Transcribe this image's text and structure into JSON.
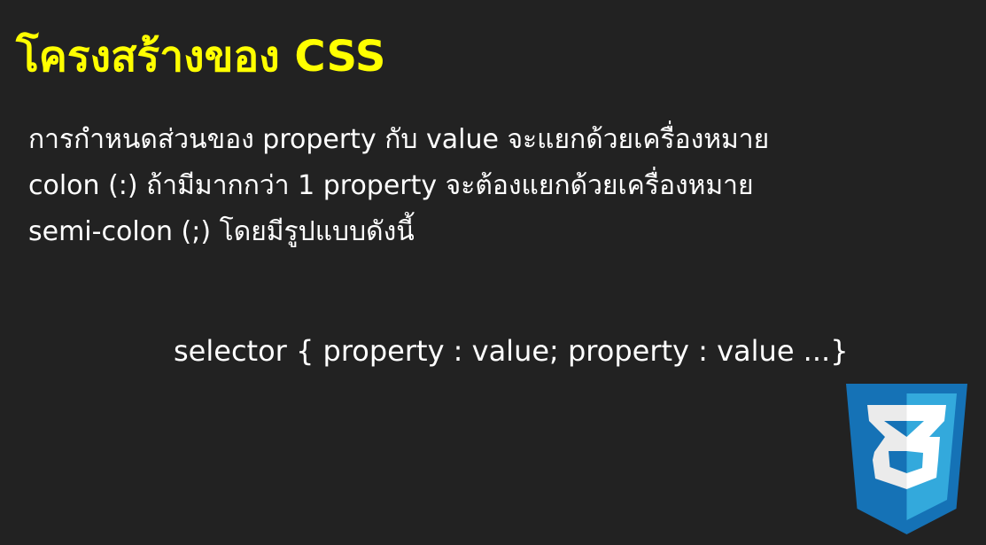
{
  "slide": {
    "title": "โครงสร้างของ CSS",
    "lines": [
      "การกำหนดส่วนของ property กับ value จะแยกด้วยเครื่องหมาย",
      "colon (:) ถ้ามีมากกว่า 1 property จะต้องแยกด้วยเครื่องหมาย",
      "semi-colon (;) โดยมีรูปแบบดังนี้"
    ],
    "syntax": "selector { property : value; property : value ...}",
    "logo_icon": "css3-logo-icon"
  },
  "colors": {
    "background": "#222222",
    "title": "#ffff00",
    "text": "#ffffff",
    "logo_dark": "#1572b6",
    "logo_light": "#33a9dc",
    "logo_3_dark": "#ebebeb",
    "logo_3_light": "#ffffff"
  }
}
